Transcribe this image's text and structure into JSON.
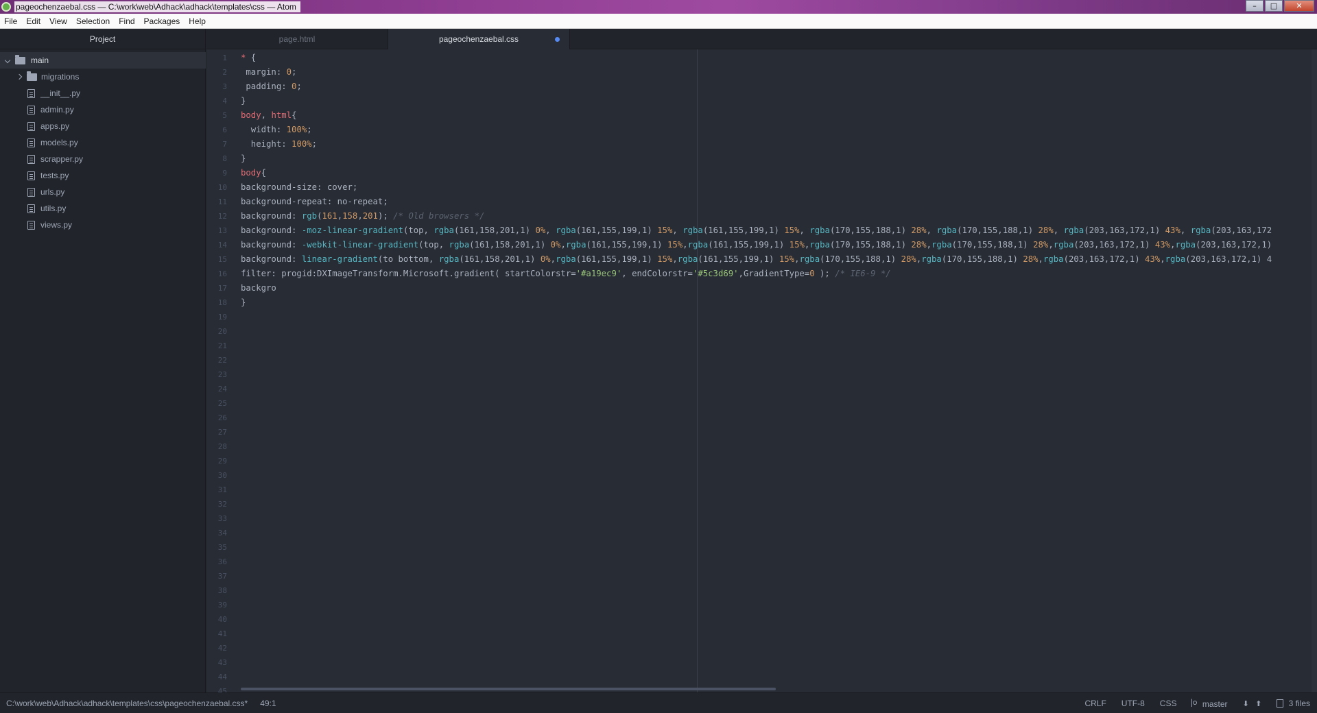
{
  "window": {
    "title": "pageochenzaebal.css — C:\\work\\web\\Adhack\\adhack\\templates\\css — Atom",
    "controls": {
      "minimize": "–",
      "maximize": "□",
      "close": "✕"
    }
  },
  "menu": [
    "File",
    "Edit",
    "View",
    "Selection",
    "Find",
    "Packages",
    "Help"
  ],
  "tree": {
    "header": "Project",
    "root": "main",
    "items": [
      {
        "label": "migrations",
        "type": "folder",
        "icon": "folder-icon"
      },
      {
        "label": "__init__.py",
        "type": "file",
        "icon": "file-icon"
      },
      {
        "label": "admin.py",
        "type": "file",
        "icon": "file-icon"
      },
      {
        "label": "apps.py",
        "type": "file",
        "icon": "file-icon"
      },
      {
        "label": "models.py",
        "type": "file",
        "icon": "file-icon"
      },
      {
        "label": "scrapper.py",
        "type": "file",
        "icon": "file-icon"
      },
      {
        "label": "tests.py",
        "type": "file",
        "icon": "file-icon"
      },
      {
        "label": "urls.py",
        "type": "file",
        "icon": "file-icon"
      },
      {
        "label": "utils.py",
        "type": "file",
        "icon": "file-icon"
      },
      {
        "label": "views.py",
        "type": "file",
        "icon": "file-icon"
      }
    ]
  },
  "tabs": [
    {
      "label": "page.html",
      "active": false,
      "modified": false
    },
    {
      "label": "pageochenzaebal.css",
      "active": true,
      "modified": true
    }
  ],
  "editor": {
    "line_count": 45,
    "lines": [
      [
        [
          "k-sel",
          "*"
        ],
        [
          "k-prop",
          " {"
        ]
      ],
      [
        [
          "k-prop",
          " margin: "
        ],
        [
          "k-num",
          "0"
        ],
        [
          "k-prop",
          ";"
        ]
      ],
      [
        [
          "k-prop",
          " padding: "
        ],
        [
          "k-num",
          "0"
        ],
        [
          "k-prop",
          ";"
        ]
      ],
      [
        [
          "k-prop",
          "}"
        ]
      ],
      [
        [
          "k-sel",
          "body"
        ],
        [
          "k-prop",
          ", "
        ],
        [
          "k-sel",
          "html"
        ],
        [
          "k-prop",
          "{"
        ]
      ],
      [
        [
          "k-prop",
          "  width: "
        ],
        [
          "k-num",
          "100%"
        ],
        [
          "k-prop",
          ";"
        ]
      ],
      [
        [
          "k-prop",
          "  height: "
        ],
        [
          "k-num",
          "100%"
        ],
        [
          "k-prop",
          ";"
        ]
      ],
      [
        [
          "k-prop",
          "}"
        ]
      ],
      [
        [
          "k-sel",
          "body"
        ],
        [
          "k-prop",
          "{"
        ]
      ],
      [
        [
          "k-prop",
          "background-size: cover;"
        ]
      ],
      [
        [
          "k-prop",
          "background-repeat: no-repeat;"
        ]
      ],
      [
        [
          "k-prop",
          "background: "
        ],
        [
          "k-fn",
          "rgb"
        ],
        [
          "k-prop",
          "("
        ],
        [
          "k-num",
          "161"
        ],
        [
          "k-prop",
          ","
        ],
        [
          "k-num",
          "158"
        ],
        [
          "k-prop",
          ","
        ],
        [
          "k-num",
          "201"
        ],
        [
          "k-prop",
          ");"
        ],
        [
          "k-cmt",
          " /* Old browsers */"
        ]
      ],
      [
        [
          "k-prop",
          "background: "
        ],
        [
          "k-fn",
          "-moz-linear-gradient"
        ],
        [
          "k-prop",
          "(top, "
        ],
        [
          "k-fn",
          "rgba"
        ],
        [
          "k-prop",
          "(161,158,201,1) "
        ],
        [
          "k-num",
          "0%"
        ],
        [
          "k-prop",
          ", "
        ],
        [
          "k-fn",
          "rgba"
        ],
        [
          "k-prop",
          "(161,155,199,1) "
        ],
        [
          "k-num",
          "15%"
        ],
        [
          "k-prop",
          ", "
        ],
        [
          "k-fn",
          "rgba"
        ],
        [
          "k-prop",
          "(161,155,199,1) "
        ],
        [
          "k-num",
          "15%"
        ],
        [
          "k-prop",
          ", "
        ],
        [
          "k-fn",
          "rgba"
        ],
        [
          "k-prop",
          "(170,155,188,1) "
        ],
        [
          "k-num",
          "28%"
        ],
        [
          "k-prop",
          ", "
        ],
        [
          "k-fn",
          "rgba"
        ],
        [
          "k-prop",
          "(170,155,188,1) "
        ],
        [
          "k-num",
          "28%"
        ],
        [
          "k-prop",
          ", "
        ],
        [
          "k-fn",
          "rgba"
        ],
        [
          "k-prop",
          "(203,163,172,1) "
        ],
        [
          "k-num",
          "43%"
        ],
        [
          "k-prop",
          ", "
        ],
        [
          "k-fn",
          "rgba"
        ],
        [
          "k-prop",
          "(203,163,172"
        ]
      ],
      [
        [
          "k-prop",
          "background: "
        ],
        [
          "k-fn",
          "-webkit-linear-gradient"
        ],
        [
          "k-prop",
          "(top, "
        ],
        [
          "k-fn",
          "rgba"
        ],
        [
          "k-prop",
          "(161,158,201,1) "
        ],
        [
          "k-num",
          "0%"
        ],
        [
          "k-prop",
          ","
        ],
        [
          "k-fn",
          "rgba"
        ],
        [
          "k-prop",
          "(161,155,199,1) "
        ],
        [
          "k-num",
          "15%"
        ],
        [
          "k-prop",
          ","
        ],
        [
          "k-fn",
          "rgba"
        ],
        [
          "k-prop",
          "(161,155,199,1) "
        ],
        [
          "k-num",
          "15%"
        ],
        [
          "k-prop",
          ","
        ],
        [
          "k-fn",
          "rgba"
        ],
        [
          "k-prop",
          "(170,155,188,1) "
        ],
        [
          "k-num",
          "28%"
        ],
        [
          "k-prop",
          ","
        ],
        [
          "k-fn",
          "rgba"
        ],
        [
          "k-prop",
          "(170,155,188,1) "
        ],
        [
          "k-num",
          "28%"
        ],
        [
          "k-prop",
          ","
        ],
        [
          "k-fn",
          "rgba"
        ],
        [
          "k-prop",
          "(203,163,172,1) "
        ],
        [
          "k-num",
          "43%"
        ],
        [
          "k-prop",
          ","
        ],
        [
          "k-fn",
          "rgba"
        ],
        [
          "k-prop",
          "(203,163,172,1)"
        ]
      ],
      [
        [
          "k-prop",
          "background: "
        ],
        [
          "k-fn",
          "linear-gradient"
        ],
        [
          "k-prop",
          "(to bottom, "
        ],
        [
          "k-fn",
          "rgba"
        ],
        [
          "k-prop",
          "(161,158,201,1) "
        ],
        [
          "k-num",
          "0%"
        ],
        [
          "k-prop",
          ","
        ],
        [
          "k-fn",
          "rgba"
        ],
        [
          "k-prop",
          "(161,155,199,1) "
        ],
        [
          "k-num",
          "15%"
        ],
        [
          "k-prop",
          ","
        ],
        [
          "k-fn",
          "rgba"
        ],
        [
          "k-prop",
          "(161,155,199,1) "
        ],
        [
          "k-num",
          "15%"
        ],
        [
          "k-prop",
          ","
        ],
        [
          "k-fn",
          "rgba"
        ],
        [
          "k-prop",
          "(170,155,188,1) "
        ],
        [
          "k-num",
          "28%"
        ],
        [
          "k-prop",
          ","
        ],
        [
          "k-fn",
          "rgba"
        ],
        [
          "k-prop",
          "(170,155,188,1) "
        ],
        [
          "k-num",
          "28%"
        ],
        [
          "k-prop",
          ","
        ],
        [
          "k-fn",
          "rgba"
        ],
        [
          "k-prop",
          "(203,163,172,1) "
        ],
        [
          "k-num",
          "43%"
        ],
        [
          "k-prop",
          ","
        ],
        [
          "k-fn",
          "rgba"
        ],
        [
          "k-prop",
          "(203,163,172,1) 4"
        ]
      ],
      [
        [
          "k-prop",
          "filter: progid:DXImageTransform.Microsoft.gradient( startColorstr="
        ],
        [
          "k-str",
          "'#a19ec9'"
        ],
        [
          "k-prop",
          ", endColorstr="
        ],
        [
          "k-str",
          "'#5c3d69'"
        ],
        [
          "k-prop",
          ",GradientType="
        ],
        [
          "k-num",
          "0"
        ],
        [
          "k-prop",
          " );"
        ],
        [
          "k-cmt",
          " /* IE6-9 */"
        ]
      ],
      [
        [
          "k-prop",
          "backgro"
        ]
      ],
      [
        [
          "k-prop",
          "}"
        ]
      ]
    ]
  },
  "status": {
    "path": "C:\\work\\web\\Adhack\\adhack\\templates\\css\\pageochenzaebal.css*",
    "cursor": "49:1",
    "line_ending": "CRLF",
    "encoding": "UTF-8",
    "grammar": "CSS",
    "branch": "master",
    "fetch_icon": "⬇",
    "push_icon": "⬆",
    "files": "3 files"
  }
}
